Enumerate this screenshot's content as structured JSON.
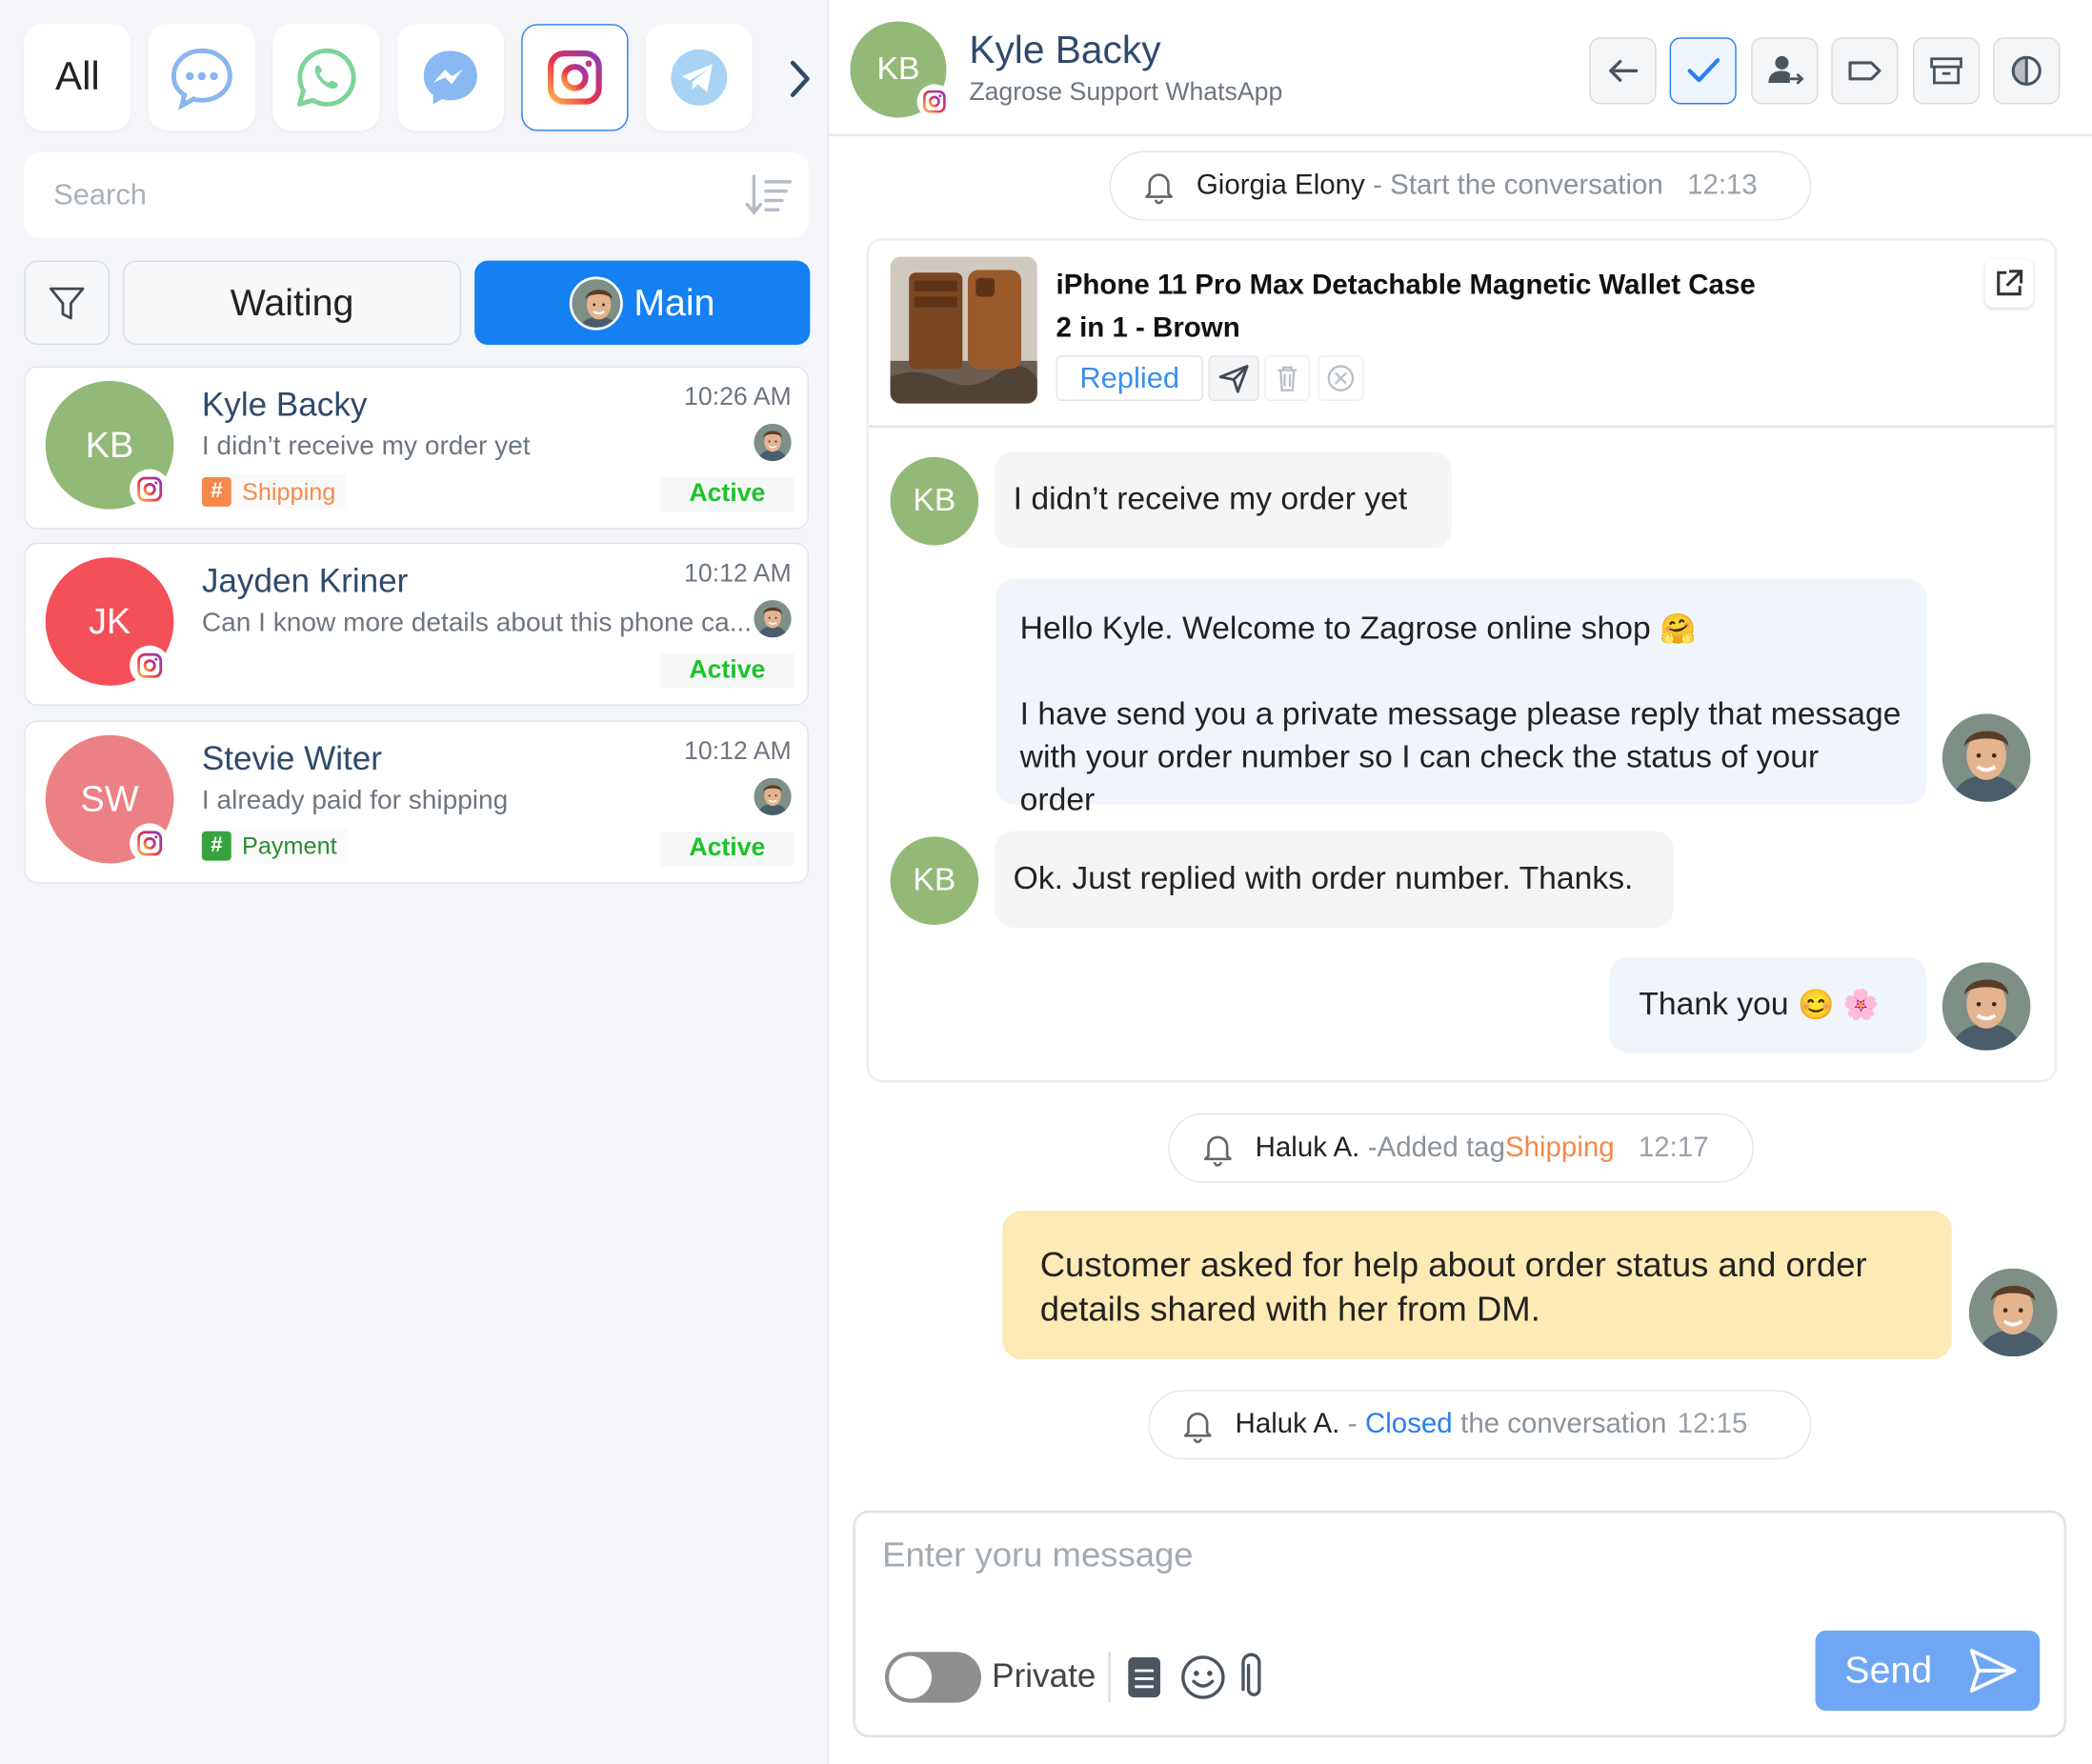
{
  "channels": {
    "all_label": "All",
    "items": [
      "chat-bubble-icon",
      "whatsapp-icon",
      "messenger-icon",
      "instagram-icon",
      "telegram-icon"
    ],
    "selected": "instagram-icon"
  },
  "search": {
    "placeholder": "Search"
  },
  "tabs": {
    "waiting": "Waiting",
    "main": "Main"
  },
  "conversations": [
    {
      "initials": "KB",
      "name": "Kyle Backy",
      "time": "10:26 AM",
      "preview": "I didn’t receive my order yet",
      "tag": "Shipping",
      "tag_color": "#f5894b",
      "status": "Active",
      "avatar_color": "#93b978"
    },
    {
      "initials": "JK",
      "name": "Jayden Kriner",
      "time": "10:12 AM",
      "preview": "Can I know more details about this phone ca...",
      "tag": "",
      "status": "Active",
      "avatar_color": "#f4505a"
    },
    {
      "initials": "SW",
      "name": "Stevie Witer",
      "time": "10:12 AM",
      "preview": "I already paid for shipping",
      "tag": "Payment",
      "tag_color": "#36a33d",
      "status": "Active",
      "avatar_color": "#eb8185"
    }
  ],
  "header": {
    "initials": "KB",
    "name": "Kyle Backy",
    "subtitle": "Zagrose Support WhatsApp",
    "buttons": [
      "back-arrow-icon",
      "check-icon",
      "assign-user-icon",
      "tag-icon",
      "archive-icon",
      "block-icon"
    ]
  },
  "events": {
    "start": {
      "who": "Giorgia Elony",
      "text": " - Start the conversation",
      "time": "12:13"
    },
    "tag": {
      "who": "Haluk A.",
      "text": " -Added tag ",
      "tag": "Shipping",
      "time": "12:17"
    },
    "closed": {
      "who": "Haluk A.",
      "text_pre": " - ",
      "closed": "Closed",
      "text_post": " the conversation",
      "time": "12:15"
    }
  },
  "product": {
    "title_line1": "iPhone 11 Pro Max Detachable Magnetic Wallet Case",
    "title_line2": "2 in 1 - Brown",
    "replied": "Replied"
  },
  "messages": {
    "m1": "I didn’t receive my order yet",
    "m2_line1": "Hello Kyle. Welcome to Zagrose online shop",
    "m2_emoji": "🤗",
    "m2_line2": "I have send you a private message please reply that message",
    "m2_line3": "with your order number so I can check the status of your order",
    "m3": "Ok. Just replied with order number. Thanks.",
    "m4": "Thank you",
    "m4_emoji": "😊 🌸"
  },
  "private_note": {
    "line1": "Customer asked for help about order status and order",
    "line2": "details shared with her from DM."
  },
  "compose": {
    "placeholder": "Enter yoru message",
    "private_label": "Private",
    "send_label": "Send"
  },
  "colors": {
    "primary": "#1480f2",
    "kb_green": "#93b978",
    "active_green": "#1ec22c",
    "note_yellow": "#fdeab4",
    "shipping_orange": "#f5894b"
  }
}
